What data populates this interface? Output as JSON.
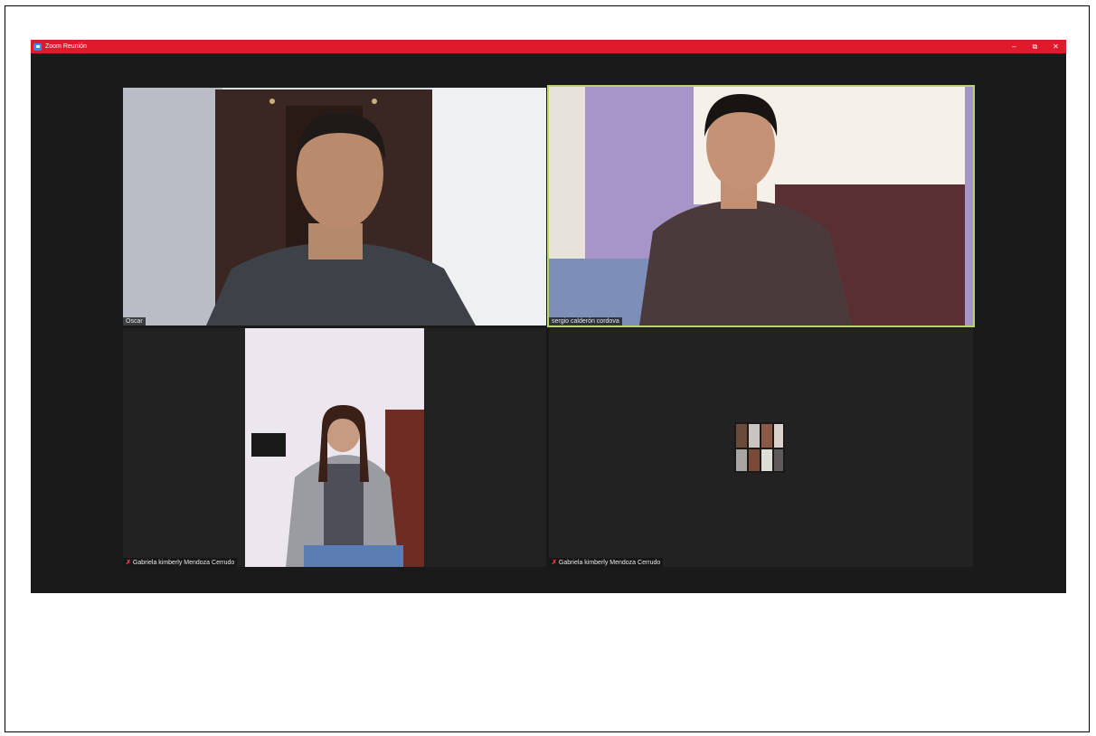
{
  "window": {
    "title": "Zoom Reunión",
    "controls": {
      "minimize": "–",
      "restore": "⧉",
      "close": "✕"
    }
  },
  "participants": [
    {
      "name": "Oscar",
      "muted": false,
      "active_speaker": false,
      "video": "on"
    },
    {
      "name": "sergio calderón cordova",
      "muted": false,
      "active_speaker": true,
      "video": "on"
    },
    {
      "name": "Gabriela kimberly Mendoza Cerrudo",
      "muted": true,
      "active_speaker": false,
      "video": "on"
    },
    {
      "name": "Gabriela kimberly Mendoza Cerrudo",
      "muted": true,
      "active_speaker": false,
      "video": "off"
    }
  ],
  "colors": {
    "titlebar": "#e0192c",
    "background": "#1a1a1a",
    "active_speaker_border": "#b9d66a",
    "muted_icon": "#ff3b3b"
  },
  "icons": {
    "app": "zoom-camera-icon",
    "muted": "mic-muted-icon"
  }
}
